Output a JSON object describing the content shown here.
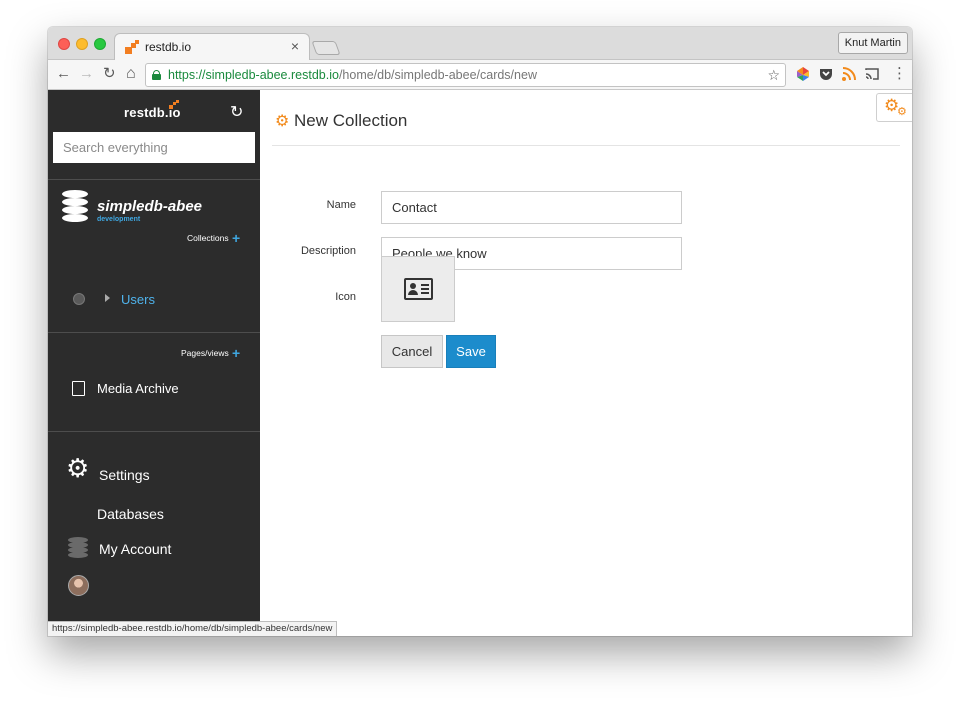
{
  "browser": {
    "tab_title": "restdb.io",
    "tab_close": "×",
    "profile_name": "Knut Martin",
    "url_host": "https://simpledb-abee.restdb.io",
    "url_path": "/home/db/simpledb-abee/cards/new",
    "status_url": "https://simpledb-abee.restdb.io/home/db/simpledb-abee/cards/new",
    "nav": {
      "back": "←",
      "forward": "→",
      "reload": "↻",
      "home": "⌂",
      "star": "☆",
      "menu": "⋮"
    }
  },
  "sidebar": {
    "brand": "restdb.io",
    "refresh_glyph": "↻",
    "search_placeholder": "Search everything",
    "database_name": "simpledb-abee",
    "database_env": "development",
    "collections_label": "Collections",
    "add_glyph": "+",
    "collections": [
      {
        "label": "Users"
      }
    ],
    "pages_label": "Pages/views",
    "pages": [
      {
        "label": "Media Archive"
      }
    ],
    "nav": {
      "settings": "Settings",
      "databases": "Databases",
      "account": "My Account"
    },
    "gear_glyph": "⚙"
  },
  "main": {
    "title": "New Collection",
    "title_icon_glyph": "⚙",
    "form": {
      "name_label": "Name",
      "name_value": "Contact",
      "description_label": "Description",
      "description_value": "People we know",
      "icon_label": "Icon",
      "icon_name": "id-card-icon"
    },
    "buttons": {
      "cancel": "Cancel",
      "save": "Save"
    }
  },
  "colors": {
    "brand_orange": "#f27e21",
    "accent_blue": "#1c8ccc",
    "link_blue": "#4fb3ec",
    "sidebar_bg": "#2c2c2c",
    "secure_green": "#1a8a3d"
  }
}
